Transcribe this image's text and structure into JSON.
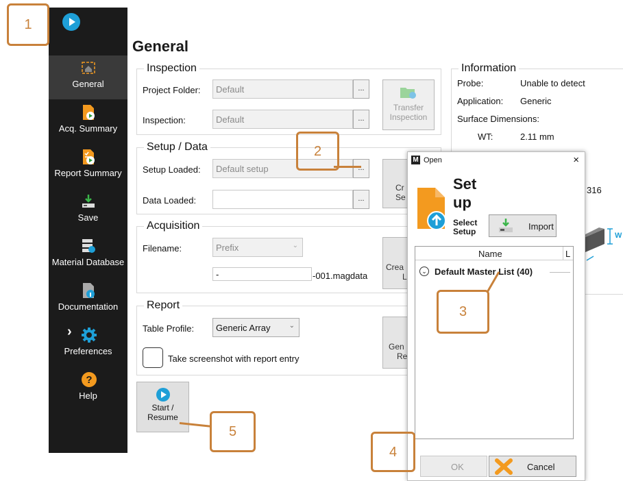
{
  "sidebar": {
    "items": [
      {
        "label": "General",
        "icon": "home-icon"
      },
      {
        "label": "Acq. Summary",
        "icon": "acquisition-summary-icon"
      },
      {
        "label": "Report Summary",
        "icon": "report-summary-icon"
      },
      {
        "label": "Save",
        "icon": "save-icon"
      },
      {
        "label": "Material Database",
        "icon": "material-database-icon"
      },
      {
        "label": "Documentation",
        "icon": "documentation-icon"
      },
      {
        "label": "Preferences",
        "icon": "gear-icon"
      },
      {
        "label": "Help",
        "icon": "help-icon"
      }
    ]
  },
  "page": {
    "title": "General"
  },
  "inspection": {
    "heading": "Inspection",
    "project_folder_label": "Project Folder:",
    "project_folder_value": "Default",
    "inspection_label": "Inspection:",
    "inspection_value": "Default",
    "browse": "...",
    "transfer_line1": "Transfer",
    "transfer_line2": "Inspection"
  },
  "setup_data": {
    "heading": "Setup / Data",
    "setup_loaded_label": "Setup Loaded:",
    "setup_loaded_value": "Default setup",
    "data_loaded_label": "Data Loaded:",
    "data_loaded_value": "",
    "browse": "...",
    "create_partial_1": "Cr",
    "create_partial_2": "Se"
  },
  "acquisition": {
    "heading": "Acquisition",
    "filename_label": "Filename:",
    "filename_mode": "Prefix",
    "prefix_value": "-",
    "suffix": "-001.magdata",
    "create_partial_1": "Crea",
    "create_partial_2": "L"
  },
  "report": {
    "heading": "Report",
    "table_profile_label": "Table Profile:",
    "table_profile_value": "Generic Array",
    "screenshot_label": "Take screenshot with report entry",
    "generate_partial_1": "Gen",
    "generate_partial_2": "Re"
  },
  "start_button": {
    "line1": "Start /",
    "line2": "Resume"
  },
  "information": {
    "heading": "Information",
    "probe_label": "Probe:",
    "probe_value": "Unable to detect",
    "application_label": "Application:",
    "application_value": "Generic",
    "surface_label": "Surface Dimensions:",
    "wt_label": "WT:",
    "wt_value": "2.11 mm",
    "partial_value": "316",
    "w_label": "W"
  },
  "dialog": {
    "title": "Open",
    "close": "×",
    "header_line1": "Set",
    "header_line2": "up",
    "subheader_line1": "Select",
    "subheader_line2": "Setup",
    "import_label": "Import",
    "column_name": "Name",
    "column_l": "L",
    "group_row": "Default Master List (40)",
    "ok_label": "OK",
    "cancel_label": "Cancel"
  },
  "callouts": [
    "1",
    "2",
    "3",
    "4",
    "5"
  ],
  "colors": {
    "accent": "#c8813a",
    "brand_blue": "#1e9fd7",
    "icon_orange": "#f39a1f",
    "sidebar_bg": "#1b1b1b"
  }
}
